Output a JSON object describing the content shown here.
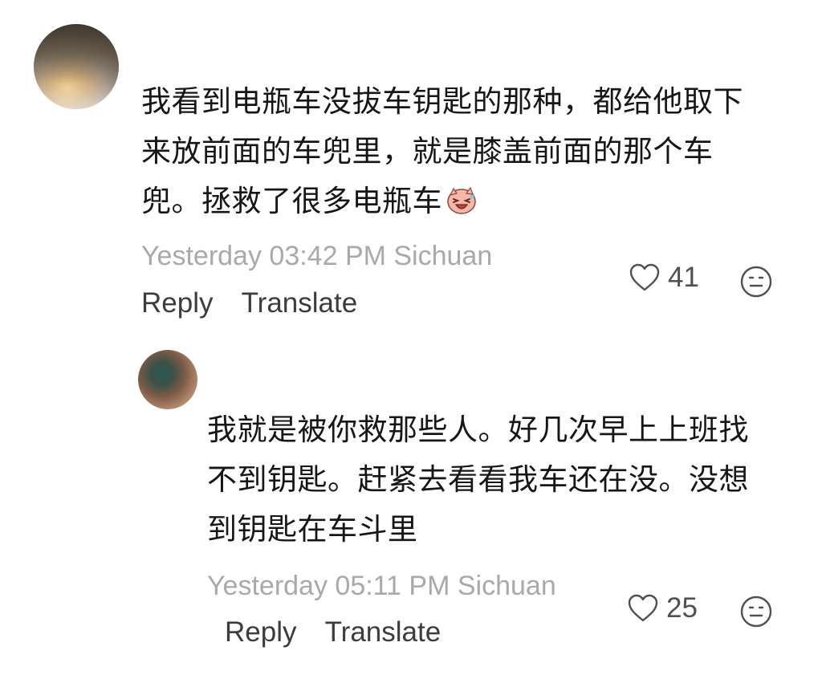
{
  "comments": [
    {
      "lines": [
        "我看到电瓶车没拔车钥匙的那种，都给他取下",
        "来放前面的车兜里，就是膝盖前面的那个车",
        "兜。拯救了很多电瓶车"
      ],
      "emoji_icon": "laughing-face-emoji-icon",
      "meta": "Yesterday 03:42 PM Sichuan",
      "reply_label": "Reply",
      "translate_label": "Translate",
      "like_count": "41"
    },
    {
      "lines": [
        "我就是被你救那些人。好几次早上上班找",
        "不到钥匙。赶紧去看看我车还在没。没想",
        "到钥匙在车斗里"
      ],
      "meta": "Yesterday 05:11 PM Sichuan",
      "reply_label": "Reply",
      "translate_label": "Translate",
      "like_count": "25"
    }
  ],
  "icons": {
    "like": "heart-outline-icon",
    "dislike": "neutral-face-icon"
  },
  "colors": {
    "text": "#161616",
    "meta": "#a9a9a9",
    "action": "#3c3c3c",
    "icon": "#505050"
  }
}
